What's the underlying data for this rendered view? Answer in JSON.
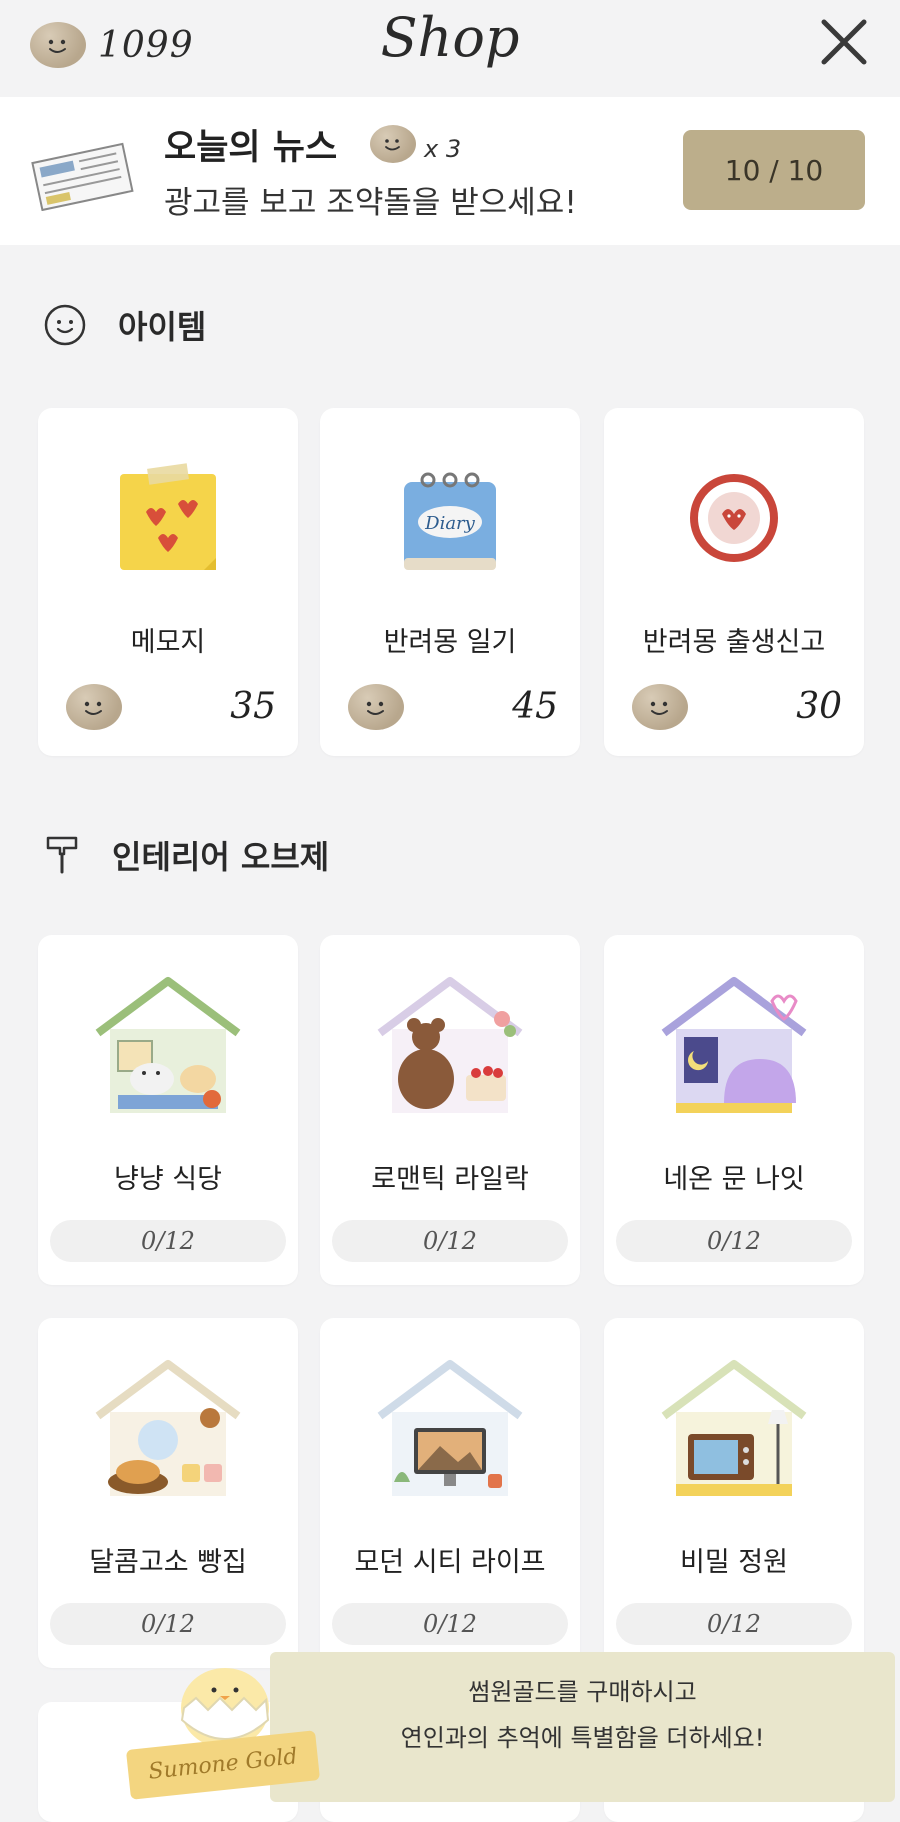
{
  "header": {
    "coin_count": "1099",
    "title": "Shop",
    "icons": {
      "currency": "pebble-currency-icon",
      "close": "close-icon"
    }
  },
  "news": {
    "title": "오늘의 뉴스",
    "multiplier": "x 3",
    "subtitle": "광고를 보고 조약돌을 받으세요!",
    "counter": "10 / 10",
    "icon": "newspaper-icon"
  },
  "items_section": {
    "title": "아이템",
    "icon": "smiley-icon",
    "items": [
      {
        "name": "메모지",
        "price": "35",
        "icon": "memo-note-icon"
      },
      {
        "name": "반려몽 일기",
        "price": "45",
        "icon": "diary-icon"
      },
      {
        "name": "반려몽 출생신고",
        "price": "30",
        "icon": "happy-mongs-day-stamp-icon"
      }
    ]
  },
  "interior_section": {
    "title": "인테리어 오브제",
    "icon": "paint-roller-icon",
    "items": [
      {
        "name": "냥냥 식당",
        "progress": "0/12",
        "icon": "cat-restaurant-house-icon"
      },
      {
        "name": "로맨틱 라일락",
        "progress": "0/12",
        "icon": "bear-lilac-house-icon"
      },
      {
        "name": "네온 문 나잇",
        "progress": "0/12",
        "icon": "neon-moon-house-icon"
      },
      {
        "name": "달콤고소 빵집",
        "progress": "0/12",
        "icon": "bakery-house-icon"
      },
      {
        "name": "모던 시티 라이프",
        "progress": "0/12",
        "icon": "modern-city-house-icon"
      },
      {
        "name": "비밀 정원",
        "progress": "0/12",
        "icon": "secret-garden-house-icon"
      }
    ]
  },
  "promo": {
    "line1": "썸원골드를 구매하시고",
    "line2": "연인과의 추억에 특별함을 더하세요!",
    "badge": "Sumone Gold",
    "icon": "egg-chick-icon"
  },
  "colors": {
    "background": "#f3f3f4",
    "card": "#ffffff",
    "news_button": "#bcae8b",
    "pebble": "#b8a78d",
    "promo_banner": "#e9e6cc"
  }
}
